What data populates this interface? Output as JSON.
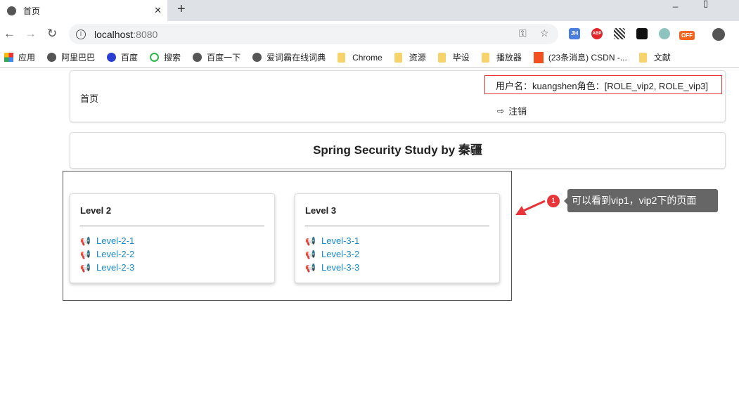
{
  "browser": {
    "tab_title": "首页",
    "url_host": "localhost",
    "url_port": ":8080",
    "bookmarks": [
      {
        "label": "应用",
        "type": "apps"
      },
      {
        "label": "阿里巴巴",
        "type": "globe"
      },
      {
        "label": "百度",
        "type": "baidu"
      },
      {
        "label": "搜索",
        "type": "search"
      },
      {
        "label": "百度一下",
        "type": "globe"
      },
      {
        "label": "爱词霸在线词典",
        "type": "globe"
      },
      {
        "label": "Chrome",
        "type": "folder"
      },
      {
        "label": "资源",
        "type": "folder"
      },
      {
        "label": "毕设",
        "type": "folder"
      },
      {
        "label": "播放器",
        "type": "folder"
      },
      {
        "label": "(23条消息) CSDN -...",
        "type": "csdn"
      },
      {
        "label": "文献",
        "type": "folder"
      }
    ],
    "extensions": [
      "JH",
      "ABP",
      "QR",
      "",
      "",
      "OFF"
    ]
  },
  "header": {
    "home": "首页",
    "user_info": "用户名：kuangshen角色：[ROLE_vip2, ROLE_vip3]",
    "logout": "注销"
  },
  "title": "Spring Security Study by 秦疆",
  "levels": [
    {
      "title": "Level 2",
      "links": [
        "Level-2-1",
        "Level-2-2",
        "Level-2-3"
      ]
    },
    {
      "title": "Level 3",
      "links": [
        "Level-3-1",
        "Level-3-2",
        "Level-3-3"
      ]
    }
  ],
  "annotation": {
    "number": "1",
    "text": "可以看到vip1，vip2下的页面"
  }
}
